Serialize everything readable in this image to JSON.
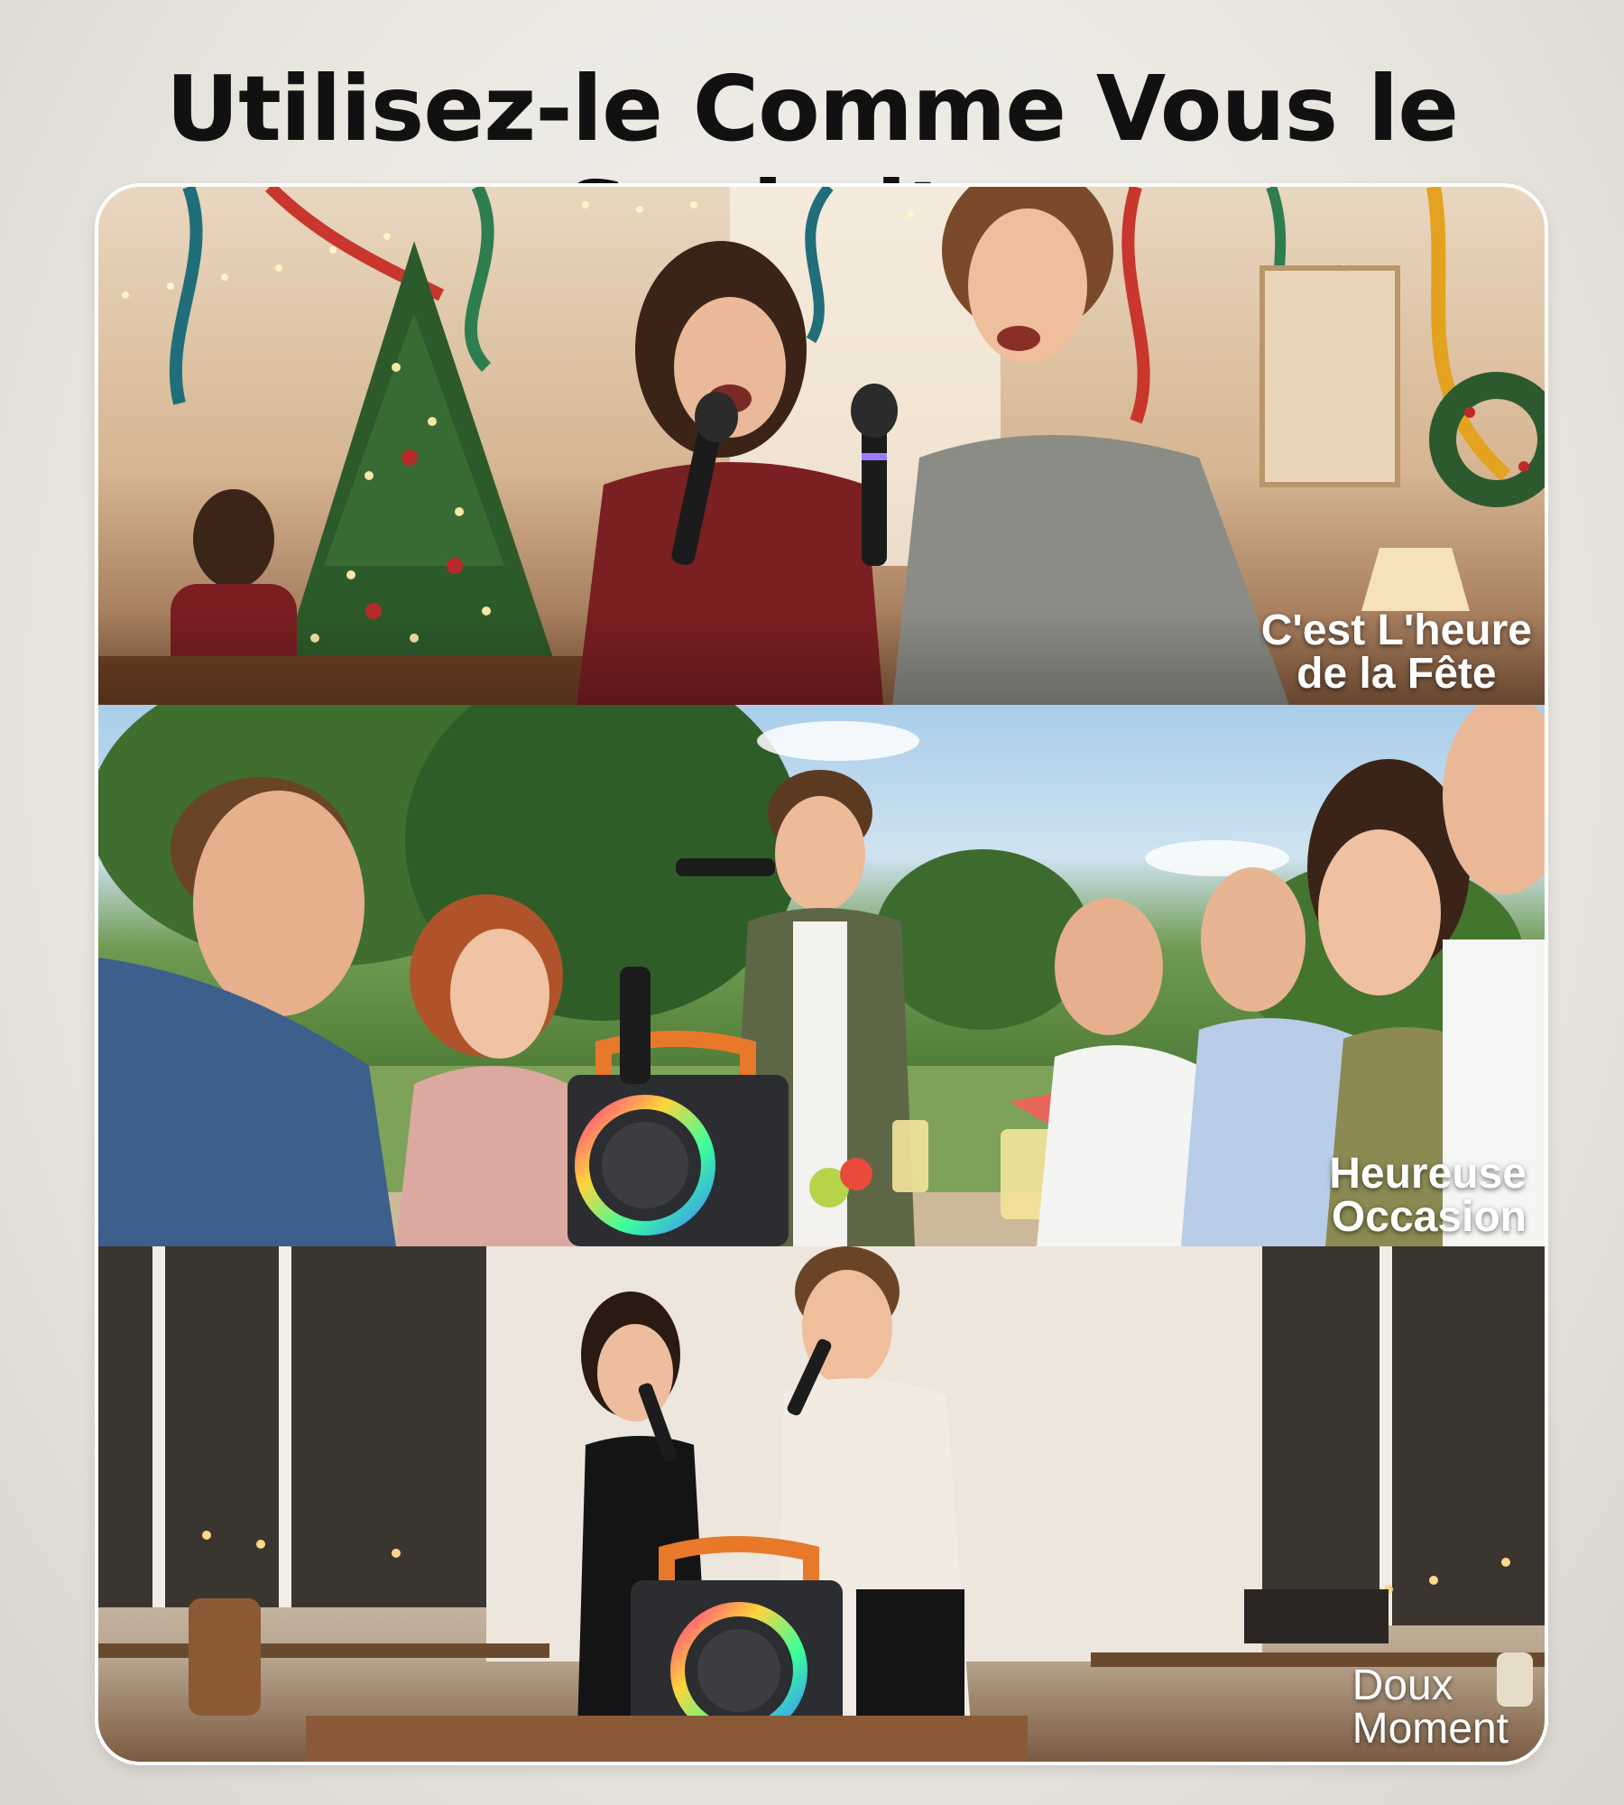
{
  "headline": "Utilisez-le Comme Vous le Souhaitez",
  "panels": [
    {
      "scene": "christmas-party",
      "caption_lines": [
        "C'est L'heure",
        "de la Fête"
      ]
    },
    {
      "scene": "outdoor-gathering",
      "caption_lines": [
        "Heureuse",
        "Occasion"
      ]
    },
    {
      "scene": "restaurant-evening",
      "caption_lines": [
        "Doux",
        "Moment"
      ]
    }
  ],
  "colors": {
    "background": "#ebe8e2",
    "headline": "#111111",
    "caption": "#ffffff",
    "speaker_handle": "#e8792a",
    "speaker_body": "#2b2d30"
  }
}
